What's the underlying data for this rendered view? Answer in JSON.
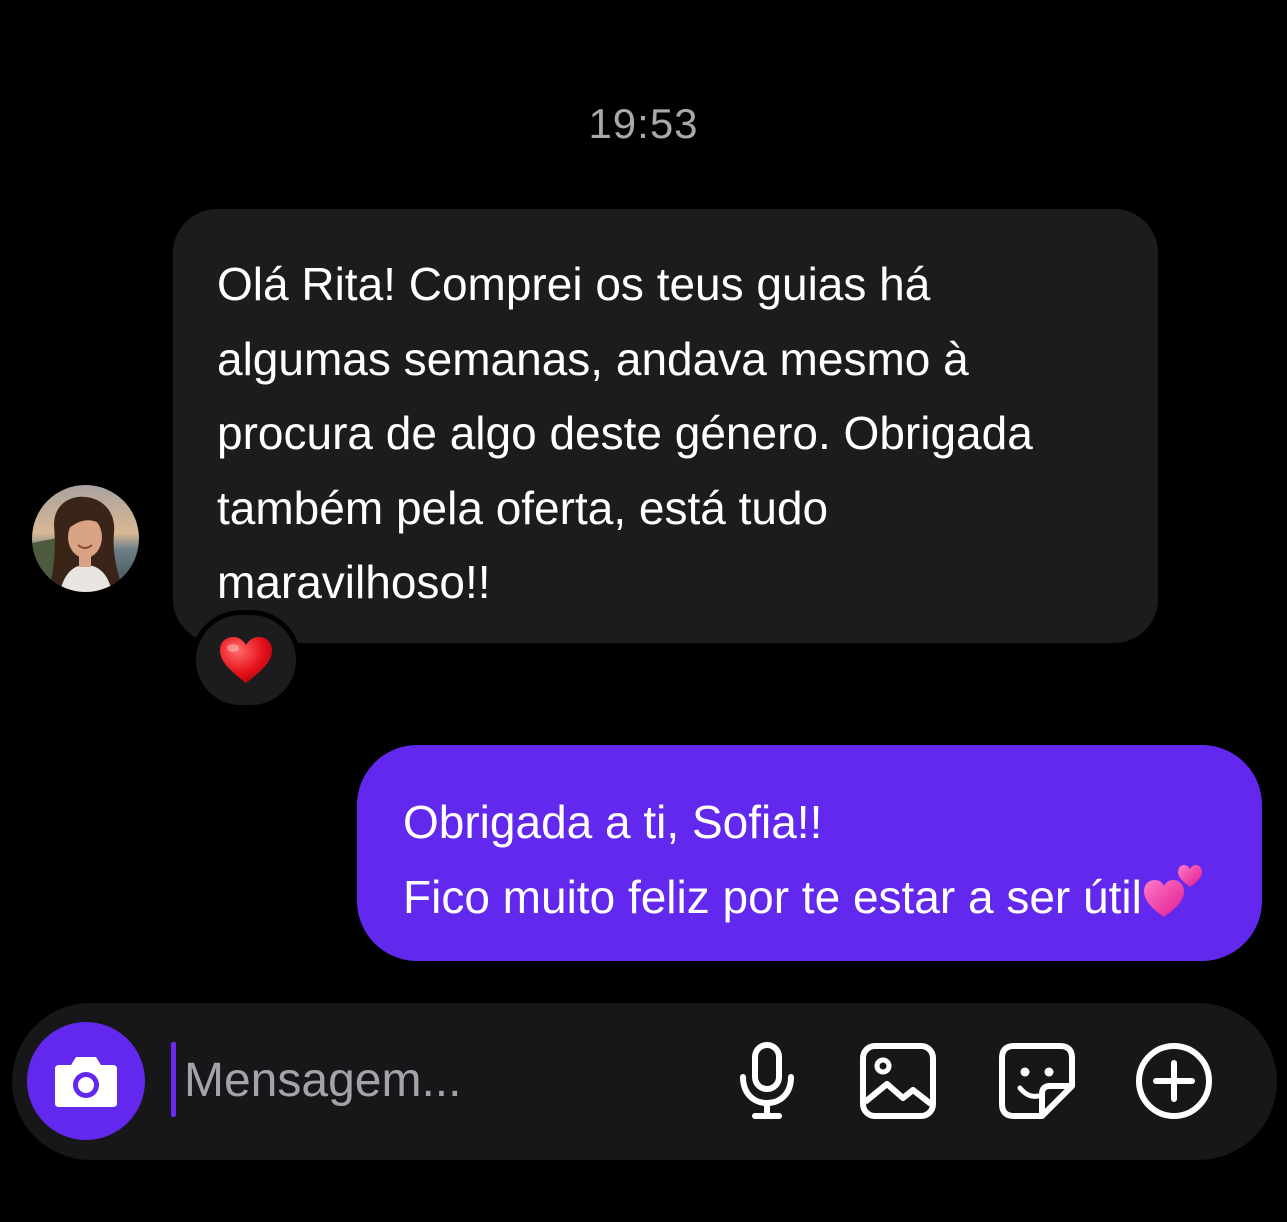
{
  "conversation": {
    "timestamp": "19:53"
  },
  "incoming_message": {
    "text": "Olá Rita! Comprei os teus guias há\nalgumas semanas, andava mesmo à\nprocura de algo deste género. Obrigada\ntambém pela oferta, está tudo\nmaravilhoso!!",
    "reaction_icon": "red-heart-emoji"
  },
  "outgoing_message": {
    "line1": "Obrigada a ti, Sofia!!",
    "line2": "Fico muito feliz por te estar a ser útil",
    "trailing_icon": "two-hearts-emoji"
  },
  "composer": {
    "placeholder": "Mensagem...",
    "icons": [
      "camera-icon",
      "microphone-icon",
      "gallery-icon",
      "sticker-icon",
      "plus-icon"
    ]
  },
  "colors": {
    "background": "#000000",
    "incoming_bubble": "#1c1c1e",
    "outgoing_bubble": "#6228ee",
    "composer": "#17171a",
    "accent": "#6228ee",
    "timestamp": "#a9a9ad"
  }
}
